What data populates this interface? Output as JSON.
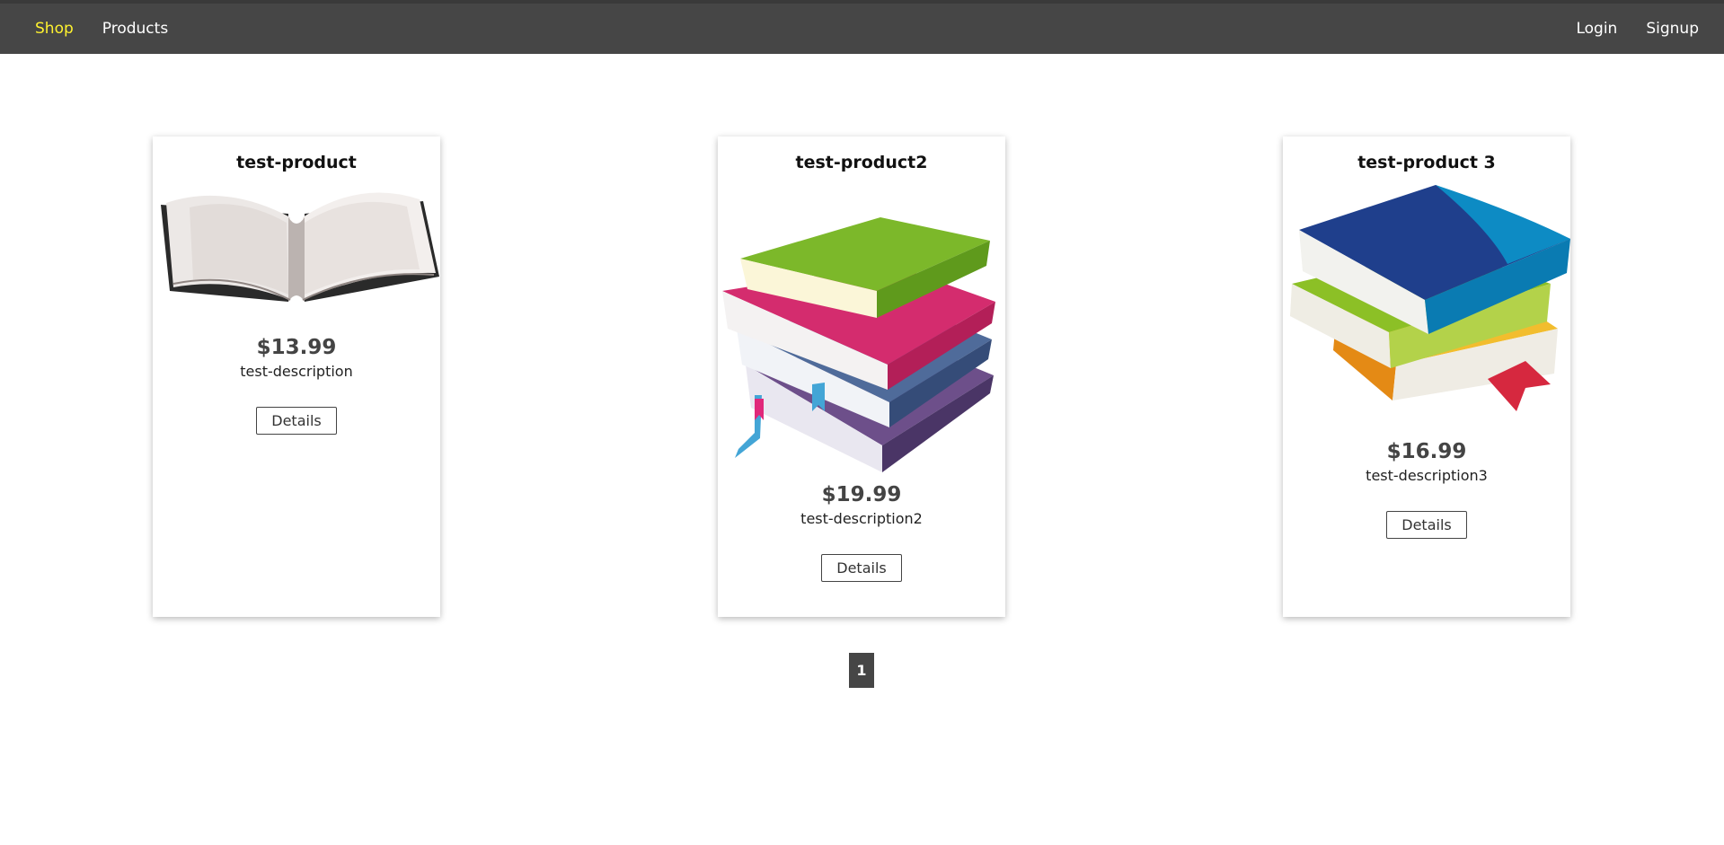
{
  "nav": {
    "brand": "Shop",
    "products": "Products",
    "login": "Login",
    "signup": "Signup"
  },
  "products": [
    {
      "title": "test-product",
      "price": "$13.99",
      "description": "test-description",
      "button": "Details",
      "image": "open-book"
    },
    {
      "title": "test-product2",
      "price": "$19.99",
      "description": "test-description2",
      "button": "Details",
      "image": "book-stack-colorful"
    },
    {
      "title": "test-product 3",
      "price": "$16.99",
      "description": "test-description3",
      "button": "Details",
      "image": "book-stack-blue-green"
    }
  ],
  "pagination": {
    "current_page": "1"
  },
  "colors": {
    "navbar": "#464646",
    "active_link": "#fff22f"
  }
}
